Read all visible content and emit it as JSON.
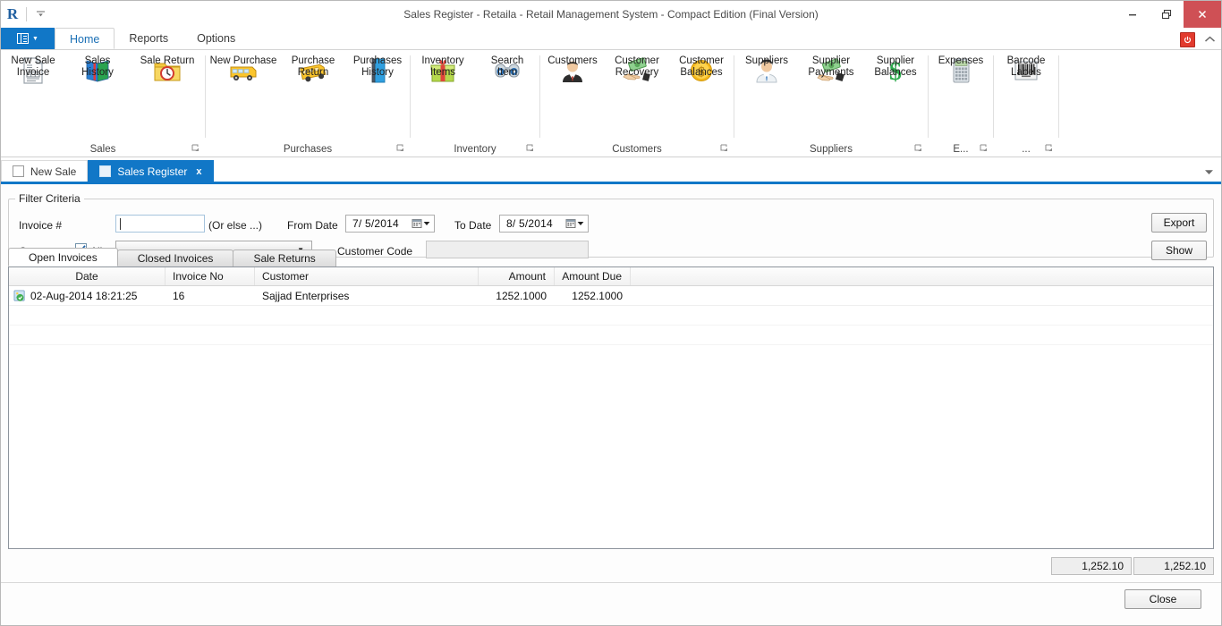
{
  "window": {
    "title": "Sales Register - Retaila - Retail Management System - Compact Edition (Final Version)",
    "logo": "R",
    "quick_access_dropdown": "qat-dropdown-icon",
    "minimize": "minimize-icon",
    "restore": "restore-icon",
    "close": "close-icon"
  },
  "ribbon": {
    "file_menu": "File",
    "tabs": [
      {
        "label": "Home",
        "active": true
      },
      {
        "label": "Reports",
        "active": false
      },
      {
        "label": "Options",
        "active": false
      }
    ],
    "right_icons": {
      "power": "power-icon",
      "collapse": "collapse-ribbon-icon"
    },
    "groups": [
      {
        "name": "Sales",
        "dialog_launcher": true,
        "items": [
          {
            "label": "New Sale\nInvoice",
            "label_lines": [
              "New Sale",
              "Invoice"
            ],
            "icon": "new-sale-invoice-icon"
          },
          {
            "label": "Sales\nHistory",
            "label_lines": [
              "Sales",
              "History"
            ],
            "icon": "sales-history-icon"
          },
          {
            "label": "Sale Return",
            "label_lines": [
              "Sale Return"
            ],
            "icon": "sale-return-icon"
          }
        ]
      },
      {
        "name": "Purchases",
        "dialog_launcher": true,
        "items": [
          {
            "label": "New Purchase",
            "label_lines": [
              "New Purchase"
            ],
            "icon": "new-purchase-icon"
          },
          {
            "label": "Purchase\nReturn",
            "label_lines": [
              "Purchase",
              "Return"
            ],
            "icon": "purchase-return-icon"
          },
          {
            "label": "Purchases\nHistory",
            "label_lines": [
              "Purchases",
              "History"
            ],
            "icon": "purchases-history-icon"
          }
        ]
      },
      {
        "name": "Inventory",
        "dialog_launcher": true,
        "items": [
          {
            "label": "Inventory\nItems",
            "label_lines": [
              "Inventory",
              "Items"
            ],
            "icon": "inventory-items-icon"
          },
          {
            "label": "Search\nItem",
            "label_lines": [
              "Search",
              "Item"
            ],
            "icon": "search-item-icon"
          }
        ]
      },
      {
        "name": "Customers",
        "dialog_launcher": true,
        "items": [
          {
            "label": "Customers",
            "label_lines": [
              "Customers"
            ],
            "icon": "customers-icon"
          },
          {
            "label": "Customer\nRecovery",
            "label_lines": [
              "Customer",
              "Recovery"
            ],
            "icon": "customer-recovery-icon"
          },
          {
            "label": "Customer\nBalances",
            "label_lines": [
              "Customer",
              "Balances"
            ],
            "icon": "customer-balances-icon"
          }
        ]
      },
      {
        "name": "Suppliers",
        "dialog_launcher": true,
        "items": [
          {
            "label": "Suppliers",
            "label_lines": [
              "Suppliers"
            ],
            "icon": "suppliers-icon"
          },
          {
            "label": "Supplier\nPayments",
            "label_lines": [
              "Supplier",
              "Payments"
            ],
            "icon": "supplier-payments-icon"
          },
          {
            "label": "Supplier\nBalances",
            "label_lines": [
              "Supplier",
              "Balances"
            ],
            "icon": "supplier-balances-icon"
          }
        ]
      },
      {
        "name": "E...",
        "dialog_launcher": true,
        "items": [
          {
            "label": "Expenses",
            "label_lines": [
              "Expenses"
            ],
            "icon": "expenses-icon"
          }
        ]
      },
      {
        "name": "...",
        "dialog_launcher": true,
        "items": [
          {
            "label": "Barcode\nLabels",
            "label_lines": [
              "Barcode",
              "Labels"
            ],
            "icon": "barcode-labels-icon"
          }
        ]
      }
    ]
  },
  "document_tabs": {
    "tabs": [
      {
        "label": "New Sale",
        "active": false,
        "closable": false
      },
      {
        "label": "Sales Register",
        "active": true,
        "closable": true,
        "close_glyph": "x"
      }
    ],
    "overflow": "tab-list-dropdown-icon"
  },
  "filter": {
    "legend": "Filter Criteria",
    "invoice_label": "Invoice #",
    "invoice_value": "",
    "invoice_placeholder": "",
    "or_else": "(Or else ...)",
    "from_date_label": "From Date",
    "from_date_value": "7/  5/2014",
    "to_date_label": "To Date",
    "to_date_value": "8/  5/2014",
    "customer_label": "Customer",
    "all_label": "All",
    "all_checked": true,
    "customer_value": "",
    "customer_code_label": "Customer Code",
    "customer_code_value": "",
    "export_button": "Export",
    "show_button": "Show"
  },
  "grid": {
    "tabs": [
      {
        "label": "Open Invoices",
        "active": true
      },
      {
        "label": "Closed Invoices",
        "active": false
      },
      {
        "label": "Sale Returns",
        "active": false
      }
    ],
    "columns": [
      "Date",
      "Invoice No",
      "Customer",
      "Amount",
      "Amount Due",
      ""
    ],
    "rows": [
      {
        "icon": "invoice-row-icon",
        "Date": "02-Aug-2014 18:21:25",
        "Invoice No": "16",
        "Customer": "Sajjad Enterprises",
        "Amount": "1252.1000",
        "Amount Due": "1252.1000"
      }
    ],
    "totals": [
      "1,252.10",
      "1,252.10"
    ]
  },
  "footer": {
    "close_button": "Close"
  },
  "colors": {
    "accent": "#1177c7",
    "close_red": "#cf5055",
    "grid_border": "#8d949c",
    "power_red": "#e23b2e"
  }
}
